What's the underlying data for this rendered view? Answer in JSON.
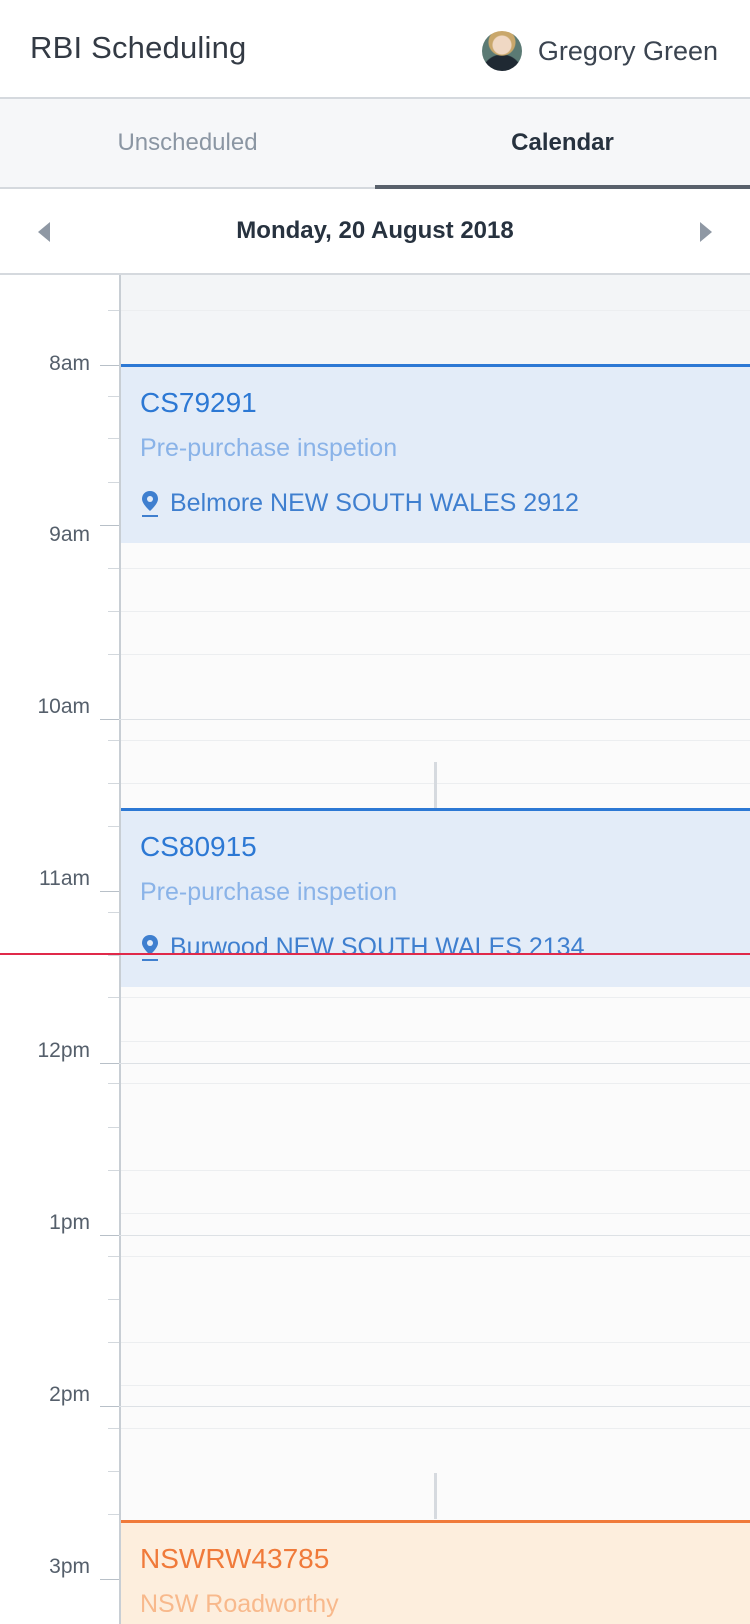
{
  "header": {
    "app_title": "RBI Scheduling",
    "user_name": "Gregory Green",
    "avatar_icon": "user-avatar"
  },
  "tabs": [
    {
      "label": "Unscheduled",
      "active": false
    },
    {
      "label": "Calendar",
      "active": true
    }
  ],
  "date_nav": {
    "date_label": "Monday, 20 August 2018",
    "prev_icon": "caret-left-icon",
    "next_icon": "caret-right-icon"
  },
  "calendar": {
    "hours": [
      "8am",
      "9am",
      "10am",
      "11am",
      "12pm",
      "1pm",
      "2pm",
      "3pm"
    ],
    "appointments": [
      {
        "id": "CS79291",
        "type": "Pre-purchase inspetion",
        "location": "Belmore NEW SOUTH WALES 2912",
        "color": "#2c78d4"
      },
      {
        "id": "CS80915",
        "type": "Pre-purchase inspetion",
        "location": "Burwood NEW SOUTH WALES 2134",
        "color": "#2c78d4"
      },
      {
        "id": "NSWRW43785",
        "type": "NSW Roadworthy",
        "location": "",
        "color": "#f07a3a"
      }
    ]
  },
  "colors": {
    "accent_blue": "#2c78d4",
    "accent_orange": "#f07a3a",
    "now_line": "#e0294a"
  }
}
